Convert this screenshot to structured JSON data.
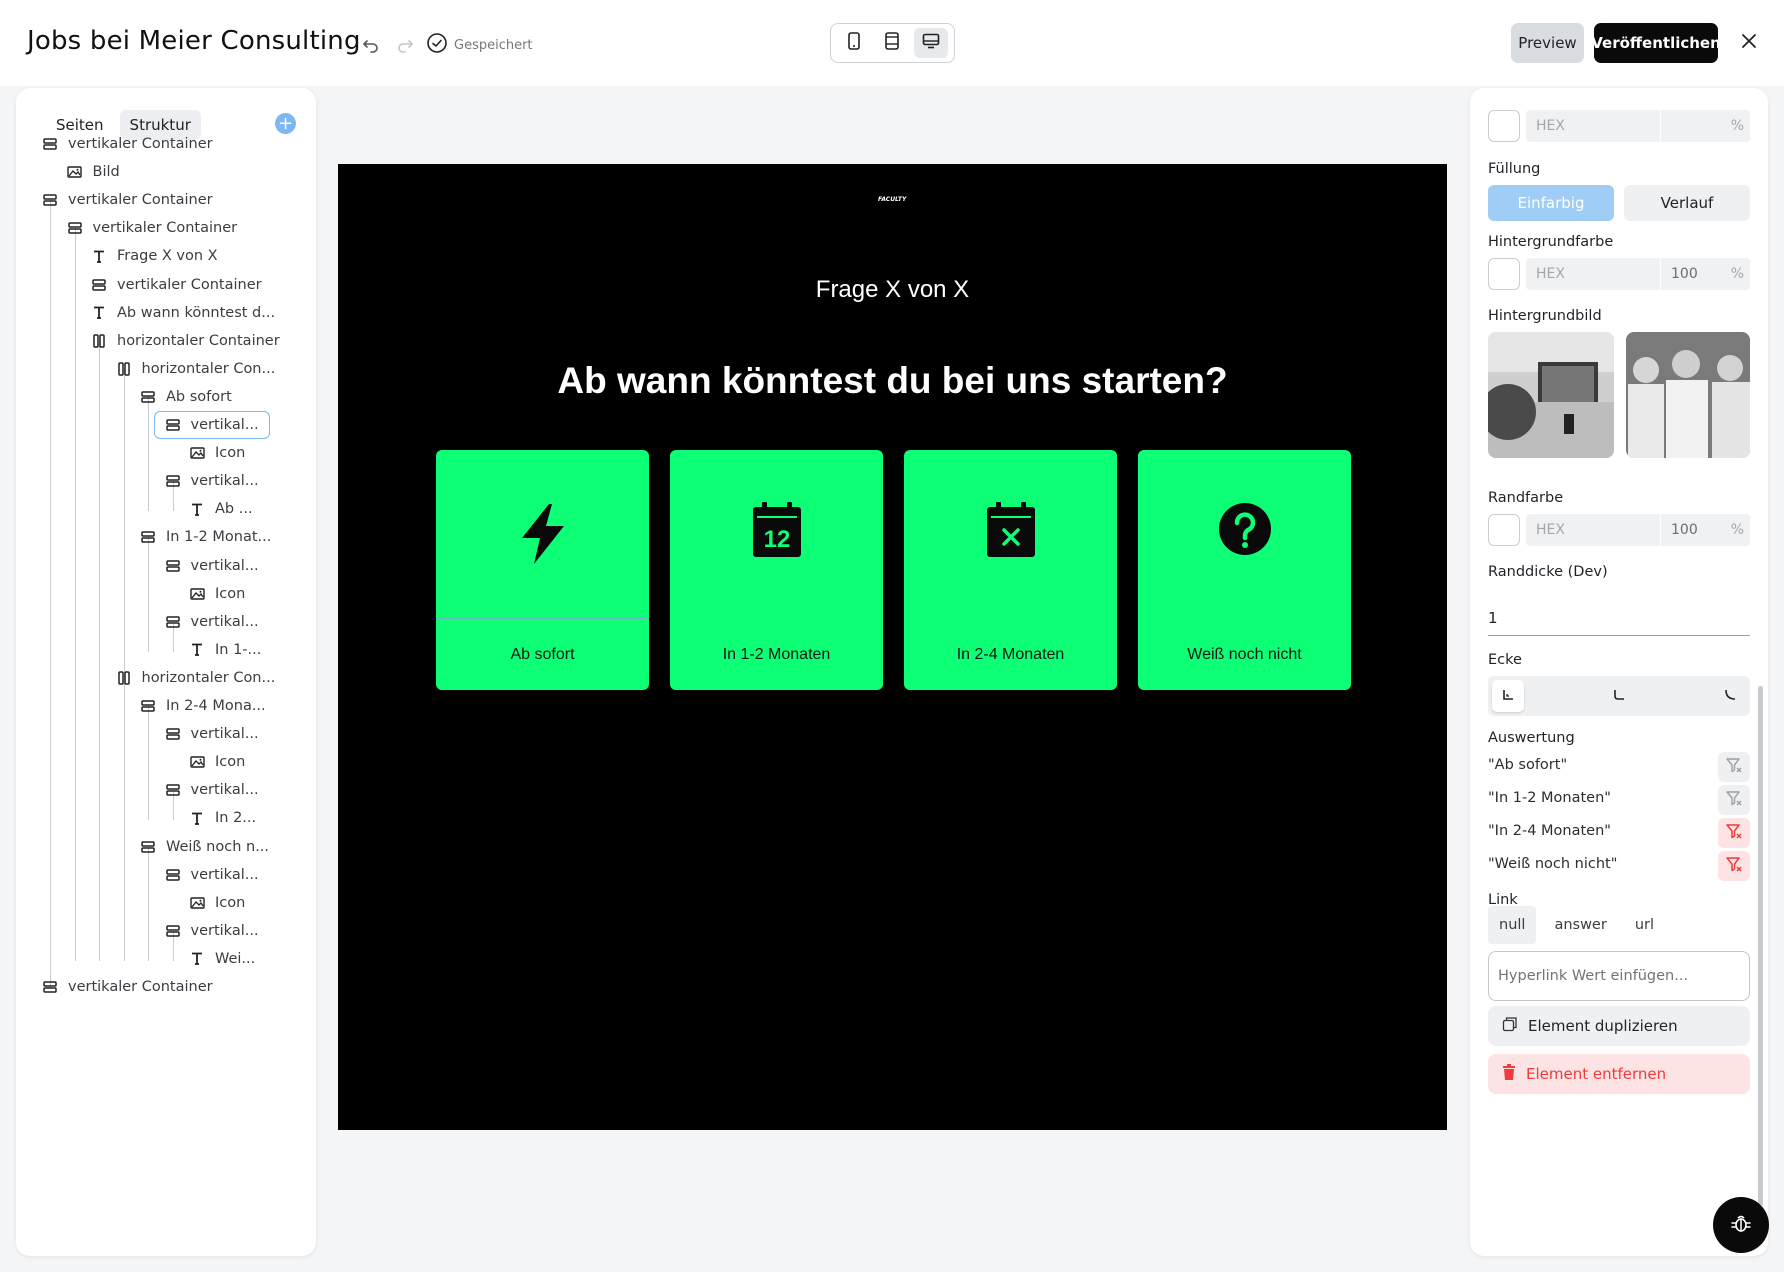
{
  "app": {
    "title": "Jobs bei Meier Consulting",
    "save_status": "Gespeichert",
    "preview_label": "Preview",
    "publish_label": "Veröffentlichen"
  },
  "left_panel": {
    "tabs": [
      "Seiten",
      "Struktur"
    ],
    "active_tab": "Struktur",
    "tree": [
      {
        "label": "vertikaler Container",
        "icon": "rows-icon"
      },
      {
        "label": "Bild",
        "icon": "image-icon"
      },
      {
        "label": "vertikaler Container",
        "icon": "rows-icon"
      },
      {
        "label": "vertikaler Container",
        "icon": "rows-icon"
      },
      {
        "label": "Frage X von X",
        "icon": "text-icon"
      },
      {
        "label": "vertikaler Container",
        "icon": "rows-icon"
      },
      {
        "label": "Ab wann könntest d...",
        "icon": "text-icon"
      },
      {
        "label": "horizontaler Container",
        "icon": "columns-icon"
      },
      {
        "label": "horizontaler Con...",
        "icon": "columns-icon"
      },
      {
        "label": "Ab sofort",
        "icon": "rows-icon"
      },
      {
        "label": "vertikal...",
        "icon": "rows-icon",
        "selected": true
      },
      {
        "label": "Icon",
        "icon": "image-icon"
      },
      {
        "label": "vertikal...",
        "icon": "rows-icon"
      },
      {
        "label": "Ab ...",
        "icon": "text-icon"
      },
      {
        "label": "In 1-2 Monat...",
        "icon": "rows-icon"
      },
      {
        "label": "vertikal...",
        "icon": "rows-icon"
      },
      {
        "label": "Icon",
        "icon": "image-icon"
      },
      {
        "label": "vertikal...",
        "icon": "rows-icon"
      },
      {
        "label": "In 1-...",
        "icon": "text-icon"
      },
      {
        "label": "horizontaler Con...",
        "icon": "columns-icon"
      },
      {
        "label": "In 2-4 Mona...",
        "icon": "rows-icon"
      },
      {
        "label": "vertikal...",
        "icon": "rows-icon"
      },
      {
        "label": "Icon",
        "icon": "image-icon"
      },
      {
        "label": "vertikal...",
        "icon": "rows-icon"
      },
      {
        "label": "In 2...",
        "icon": "text-icon"
      },
      {
        "label": "Weiß noch n...",
        "icon": "rows-icon"
      },
      {
        "label": "vertikal...",
        "icon": "rows-icon"
      },
      {
        "label": "Icon",
        "icon": "image-icon"
      },
      {
        "label": "vertikal...",
        "icon": "rows-icon"
      },
      {
        "label": "Wei...",
        "icon": "text-icon"
      },
      {
        "label": "vertikaler Container",
        "icon": "rows-icon"
      }
    ]
  },
  "canvas": {
    "logo": "FACULTY",
    "question_number": "Frage X von X",
    "question": "Ab wann könntest du bei uns starten?",
    "answers": [
      {
        "label": "Ab sofort",
        "icon": "lightning-icon"
      },
      {
        "label": "In 1-2 Monaten",
        "icon": "calendar-12-icon"
      },
      {
        "label": "In 2-4 Monaten",
        "icon": "calendar-x-icon"
      },
      {
        "label": "Weiß noch nicht",
        "icon": "question-circle-icon"
      }
    ],
    "background_color": "#000000",
    "card_color": "#0dff76"
  },
  "right_panel": {
    "top_color": {
      "hex_placeholder": "HEX",
      "percent_sign": "%"
    },
    "fill": {
      "label": "Füllung",
      "options": [
        "Einfarbig",
        "Verlauf"
      ],
      "active": "Einfarbig"
    },
    "background_color": {
      "label": "Hintergrundfarbe",
      "hex_placeholder": "HEX",
      "opacity": "100",
      "percent_sign": "%"
    },
    "background_image": {
      "label": "Hintergrundbild"
    },
    "border_color": {
      "label": "Randfarbe",
      "hex_placeholder": "HEX",
      "opacity": "100",
      "percent_sign": "%"
    },
    "border_width": {
      "label": "Randdicke (Dev)",
      "value": "1"
    },
    "corner": {
      "label": "Ecke"
    },
    "evaluation": {
      "label": "Auswertung",
      "items": [
        {
          "label": "\"Ab sofort\"",
          "filter_active": false
        },
        {
          "label": "\"In 1-2 Monaten\"",
          "filter_active": false
        },
        {
          "label": "\"In 2-4 Monaten\"",
          "filter_active": true
        },
        {
          "label": "\"Weiß noch nicht\"",
          "filter_active": true
        }
      ]
    },
    "link": {
      "label": "Link",
      "tabs": [
        "null",
        "answer",
        "url"
      ],
      "active_tab": "null",
      "placeholder": "Hyperlink Wert einfügen..."
    },
    "duplicate_label": "Element duplizieren",
    "delete_label": "Element entfernen"
  },
  "colors": {
    "accent_green": "#0dff76",
    "accent_blue": "#7db8f2",
    "danger": "#ef3b3b"
  }
}
